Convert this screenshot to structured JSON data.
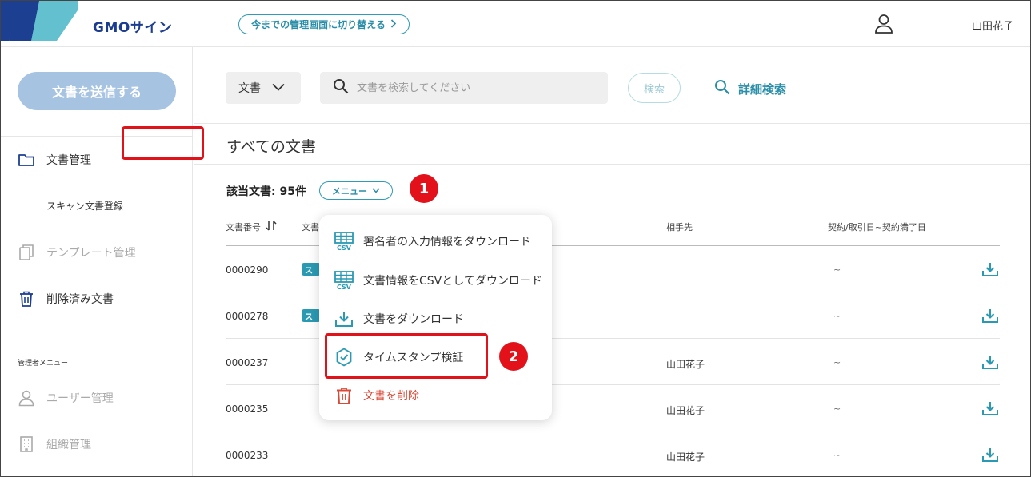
{
  "header": {
    "logo_text": "GMOサイン",
    "switch_label": "今までの管理画面に切り替える",
    "user_name": "山田花子"
  },
  "sidebar": {
    "send_button": "文書を送信する",
    "items": [
      {
        "label": "文書管理",
        "icon": "folder-icon"
      },
      {
        "label": "スキャン文書登録"
      },
      {
        "label": "テンプレート管理",
        "icon": "template-icon"
      },
      {
        "label": "削除済み文書",
        "icon": "trash-icon"
      }
    ],
    "admin_caption": "管理者メニュー",
    "admin_items": [
      {
        "label": "ユーザー管理",
        "icon": "user-icon"
      },
      {
        "label": "組織管理",
        "icon": "building-icon"
      }
    ]
  },
  "search": {
    "type_value": "文書",
    "placeholder": "文書を検索してください",
    "search_button": "検索",
    "advanced": "詳細検索"
  },
  "main": {
    "title": "すべての文書",
    "count_label": "該当文書: 95件",
    "menu_button": "メニュー",
    "columns": {
      "doc_no": "文書番号",
      "doc_name": "文書",
      "party": "相手先",
      "date": "契約/取引日~契約満了日"
    },
    "rows": [
      {
        "no": "0000290",
        "tag": "ス",
        "party": "",
        "date": "~"
      },
      {
        "no": "0000278",
        "tag": "ス",
        "party": "",
        "date": "~"
      },
      {
        "no": "0000237",
        "tag": "",
        "party": "山田花子",
        "date": "~"
      },
      {
        "no": "0000235",
        "tag": "",
        "party": "山田花子",
        "date": "~"
      },
      {
        "no": "0000233",
        "tag": "",
        "party": "山田花子",
        "date": "~"
      }
    ]
  },
  "dropdown": {
    "items": [
      {
        "label": "署名者の入力情報をダウンロード",
        "icon": "csv-icon"
      },
      {
        "label": "文書情報をCSVとしてダウンロード",
        "icon": "csv-icon"
      },
      {
        "label": "文書をダウンロード",
        "icon": "download-icon"
      },
      {
        "label": "タイムスタンプ検証",
        "icon": "check-circle-icon"
      },
      {
        "label": "文書を削除",
        "icon": "trash-icon"
      }
    ]
  },
  "annotations": {
    "step1": "1",
    "step2": "2"
  },
  "colors": {
    "accent": "#2a9ab3",
    "highlight": "#e0131b",
    "danger": "#d94a38",
    "send_button": "#a7c3e2"
  }
}
